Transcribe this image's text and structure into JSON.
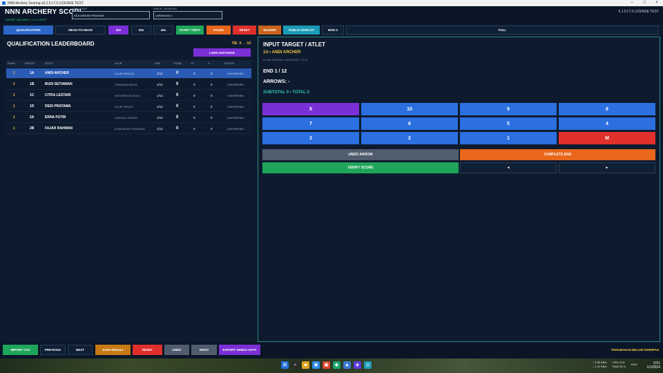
{
  "window": {
    "title": "NNN Archery Scoring v0.1.0 LT.3 LICENSE TEST"
  },
  "header": {
    "app_title": "NNN ARCHERY SCORI",
    "app_subtitle": "TARGET ARCHERY • 70 m TEST",
    "event_label": "NAMA EVENT",
    "event_value": "KEJUARAAN PANAHAN",
    "venue_label": "VENUE / LAPANGAN",
    "venue_value": "LAPANGAN 1",
    "version": "0.1.0 LT.3 LICENSE TEST"
  },
  "toolbar": {
    "qualification": "QUALIFICATION",
    "head_to_head": "HEAD-TO-HEAD",
    "t20": "20s",
    "t30": "30s",
    "t40": "40s",
    "start_next": "START / NEXT",
    "pause": "PAUSE",
    "reset": "RESET",
    "buzzer": "BUZZER",
    "public_display": "PUBLIC DISPLAY",
    "mon2": "MON 2",
    "full": "FULL"
  },
  "leaderboard": {
    "title": "QUALIFICATION LEADERBOARD",
    "tie_rule": "TIE: X → 10",
    "long_distance": "LONG DISTANCE",
    "columns": [
      "RANK",
      "TARGET",
      "ATLET",
      "KLUB",
      "END",
      "TOTAL",
      "10",
      "X",
      "STATUS"
    ],
    "rows": [
      {
        "rank": "1",
        "target": "1A",
        "athlete": "ANDI ARCHER",
        "club": "KLUB GARUDA",
        "end": "1/12",
        "total": "0",
        "tens": "0",
        "x": "0",
        "status": "UNVERIFIED"
      },
      {
        "rank": "1",
        "target": "1B",
        "athlete": "BUDI SETIAWAN",
        "club": "PURNAMA MUDA",
        "end": "1/12",
        "total": "0",
        "tens": "0",
        "x": "0",
        "status": "UNVERIFIED"
      },
      {
        "rank": "1",
        "target": "1C",
        "athlete": "CITRA LESTARI",
        "club": "ARCHERY SCHOOL",
        "end": "1/12",
        "total": "0",
        "tens": "0",
        "x": "0",
        "status": "UNVERIFIED"
      },
      {
        "rank": "1",
        "target": "1D",
        "athlete": "DEDI PRATAMA",
        "club": "KLUB TARGET",
        "end": "1/12",
        "total": "0",
        "tens": "0",
        "x": "0",
        "status": "UNVERIFIED"
      },
      {
        "rank": "1",
        "target": "2A",
        "athlete": "ERNA PUTRI",
        "club": "GARUDA JUNIOR",
        "end": "1/12",
        "total": "0",
        "tens": "0",
        "x": "0",
        "status": "UNVERIFIED"
      },
      {
        "rank": "1",
        "target": "2B",
        "athlete": "FAJAR RAHMAN",
        "club": "KOMUNITAS PANAHAN",
        "end": "1/12",
        "total": "0",
        "tens": "0",
        "x": "0",
        "status": "UNVERIFIED"
      }
    ]
  },
  "input_panel": {
    "title": "INPUT TARGET / ATLET",
    "athlete": "1A • ANDI ARCHER",
    "club_line": "KLUB GARUDA • RECURVE • 70 m",
    "end": "END 1 / 12",
    "arrows": "ARROWS: -",
    "subtotal": "SUBTOTAL 0  •  TOTAL 0",
    "keys": [
      "X",
      "10",
      "9",
      "8",
      "7",
      "6",
      "5",
      "4",
      "3",
      "2",
      "1",
      "M"
    ],
    "undo_arrow": "UNDO ARROW",
    "complete_end": "COMPLETE END",
    "verify_score": "VERIFY SCORE",
    "prev_arrow": "◄",
    "next_arrow": "►"
  },
  "bottom": {
    "import_csv": "IMPORT CSV",
    "previous": "PREVIOUS",
    "next": "NEXT",
    "save_result": "SAVE RESULT",
    "reset": "RESET",
    "undo": "UNDO",
    "redo": "REDO",
    "export": "EXPORT SEMUA DATA",
    "status": "PERUBAHAN BELUM DISIMPAN"
  },
  "taskbar": {
    "net_up": "↑ 2.58 KB/s",
    "net_down": "↓ 1.01 KB/s",
    "cpu": "CPU 11%",
    "ram": "RAM 26 %",
    "lang": "ENG",
    "time": "0:51",
    "date": "1/1/2024"
  },
  "colors": {
    "background": "#0c1a2e",
    "accent_blue": "#2b67c9",
    "purple": "#7b2fd6",
    "green": "#1fa55a",
    "orange": "#e8671a",
    "red": "#e0302c",
    "gold": "#f5c542",
    "teal": "#2ec4b6"
  }
}
